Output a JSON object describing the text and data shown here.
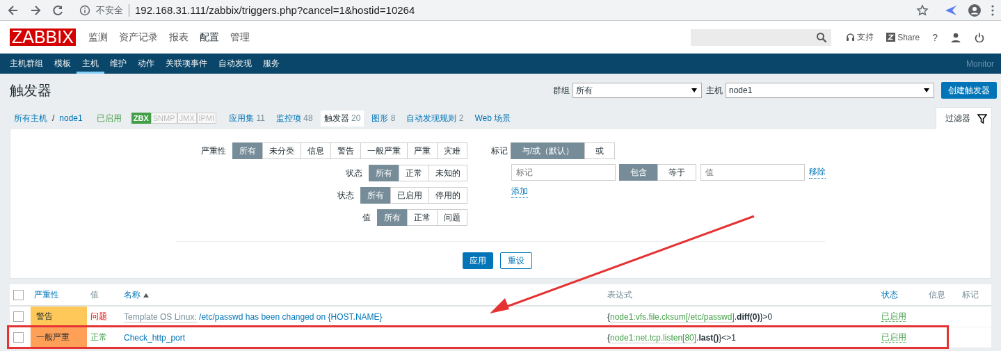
{
  "browser": {
    "security": "不安全",
    "url": "192.168.31.111/zabbix/triggers.php?cancel=1&hostid=10264"
  },
  "logo": "ZABBIX",
  "main_menu": [
    {
      "label": "监测",
      "selected": false
    },
    {
      "label": "资产记录",
      "selected": false
    },
    {
      "label": "报表",
      "selected": false
    },
    {
      "label": "配置",
      "selected": true
    },
    {
      "label": "管理",
      "selected": false
    }
  ],
  "header_links": {
    "support": "支持",
    "share": "Share",
    "help": "?"
  },
  "sub_menu": [
    {
      "label": "主机群组",
      "selected": false
    },
    {
      "label": "模板",
      "selected": false
    },
    {
      "label": "主机",
      "selected": true
    },
    {
      "label": "维护",
      "selected": false
    },
    {
      "label": "动作",
      "selected": false
    },
    {
      "label": "关联项事件",
      "selected": false
    },
    {
      "label": "自动发现",
      "selected": false
    },
    {
      "label": "服务",
      "selected": false
    }
  ],
  "server_name": "Monitor",
  "page_title": "触发器",
  "selectors": [
    {
      "label": "群组",
      "value": "所有"
    },
    {
      "label": "主机",
      "value": "node1"
    }
  ],
  "create_button": "创建触发器",
  "host_nav": {
    "breadcrumb": [
      "所有主机",
      "node1"
    ],
    "separator": "/",
    "status": "已启用",
    "availability": [
      {
        "label": "ZBX",
        "on": true
      },
      {
        "label": "SNMP",
        "on": false
      },
      {
        "label": "JMX",
        "on": false
      },
      {
        "label": "IPMI",
        "on": false
      }
    ],
    "tabs": [
      {
        "label": "应用集",
        "count": "11",
        "selected": false
      },
      {
        "label": "监控项",
        "count": "48",
        "selected": false
      },
      {
        "label": "触发器",
        "count": "20",
        "selected": true
      },
      {
        "label": "图形",
        "count": "8",
        "selected": false
      },
      {
        "label": "自动发现规则",
        "count": "2",
        "selected": false
      },
      {
        "label": "Web 场景",
        "selected": false
      }
    ]
  },
  "filter_tab": "过滤器",
  "filter": {
    "groups": [
      {
        "label": "严重性",
        "options": [
          {
            "label": "所有",
            "selected": true
          },
          {
            "label": "未分类",
            "selected": false
          },
          {
            "label": "信息",
            "selected": false
          },
          {
            "label": "警告",
            "selected": false
          },
          {
            "label": "一般严重",
            "selected": false
          },
          {
            "label": "严重",
            "selected": false
          },
          {
            "label": "灾难",
            "selected": false
          }
        ]
      },
      {
        "label": "状态",
        "options": [
          {
            "label": "所有",
            "selected": true
          },
          {
            "label": "正常",
            "selected": false
          },
          {
            "label": "未知的",
            "selected": false
          }
        ]
      },
      {
        "label": "状态",
        "options": [
          {
            "label": "所有",
            "selected": true
          },
          {
            "label": "已启用",
            "selected": false
          },
          {
            "label": "停用的",
            "selected": false
          }
        ]
      },
      {
        "label": "值",
        "options": [
          {
            "label": "所有",
            "selected": true
          },
          {
            "label": "正常",
            "selected": false
          },
          {
            "label": "问题",
            "selected": false
          }
        ]
      }
    ],
    "tags": {
      "label": "标记",
      "mode": [
        {
          "label": "与/或（默认）",
          "selected": true
        },
        {
          "label": "或",
          "selected": false
        }
      ],
      "tag_placeholder": "标记",
      "operator": [
        {
          "label": "包含",
          "selected": true
        },
        {
          "label": "等于",
          "selected": false
        }
      ],
      "value_placeholder": "值",
      "remove": "移除",
      "add": "添加"
    },
    "apply": "应用",
    "reset": "重设"
  },
  "table": {
    "select_all": {
      "checked": false
    },
    "columns": [
      {
        "label": "严重性",
        "sortable": true,
        "sorted": false
      },
      {
        "label": "值",
        "sortable": false,
        "sorted": false
      },
      {
        "label": "名称",
        "sortable": true,
        "sorted": true
      },
      {
        "label": "表达式",
        "sortable": false,
        "sorted": false
      },
      {
        "label": "状态",
        "sortable": true,
        "sorted": false
      },
      {
        "label": "信息",
        "sortable": false,
        "sorted": false
      },
      {
        "label": "标记",
        "sortable": false,
        "sorted": false
      }
    ],
    "rows": [
      {
        "checked": false,
        "severity": "警告",
        "color": "#ffc859",
        "value": "问题",
        "problem": true,
        "template": "Template OS Linux:",
        "name": "/etc/passwd has been changed on {HOST.NAME}",
        "expression": [
          {
            "kind": "plain",
            "text": "{"
          },
          {
            "kind": "key",
            "text": "node1:vfs.file.cksum[/etc/passwd]"
          },
          {
            "kind": "plain",
            "text": "."
          },
          {
            "kind": "func",
            "text": "diff(0)"
          },
          {
            "kind": "plain",
            "text": "}>0"
          }
        ],
        "status": "已启用",
        "highlighted": false
      },
      {
        "checked": false,
        "severity": "一般严重",
        "color": "#ffa059",
        "value": "正常",
        "problem": false,
        "name": "Check_http_port",
        "expression": [
          {
            "kind": "plain",
            "text": "{"
          },
          {
            "kind": "key",
            "text": "node1:net.tcp.listen[80]"
          },
          {
            "kind": "plain",
            "text": "."
          },
          {
            "kind": "func",
            "text": "last()"
          },
          {
            "kind": "plain",
            "text": "}<>1"
          }
        ],
        "status": "已启用",
        "highlighted": true
      }
    ]
  }
}
